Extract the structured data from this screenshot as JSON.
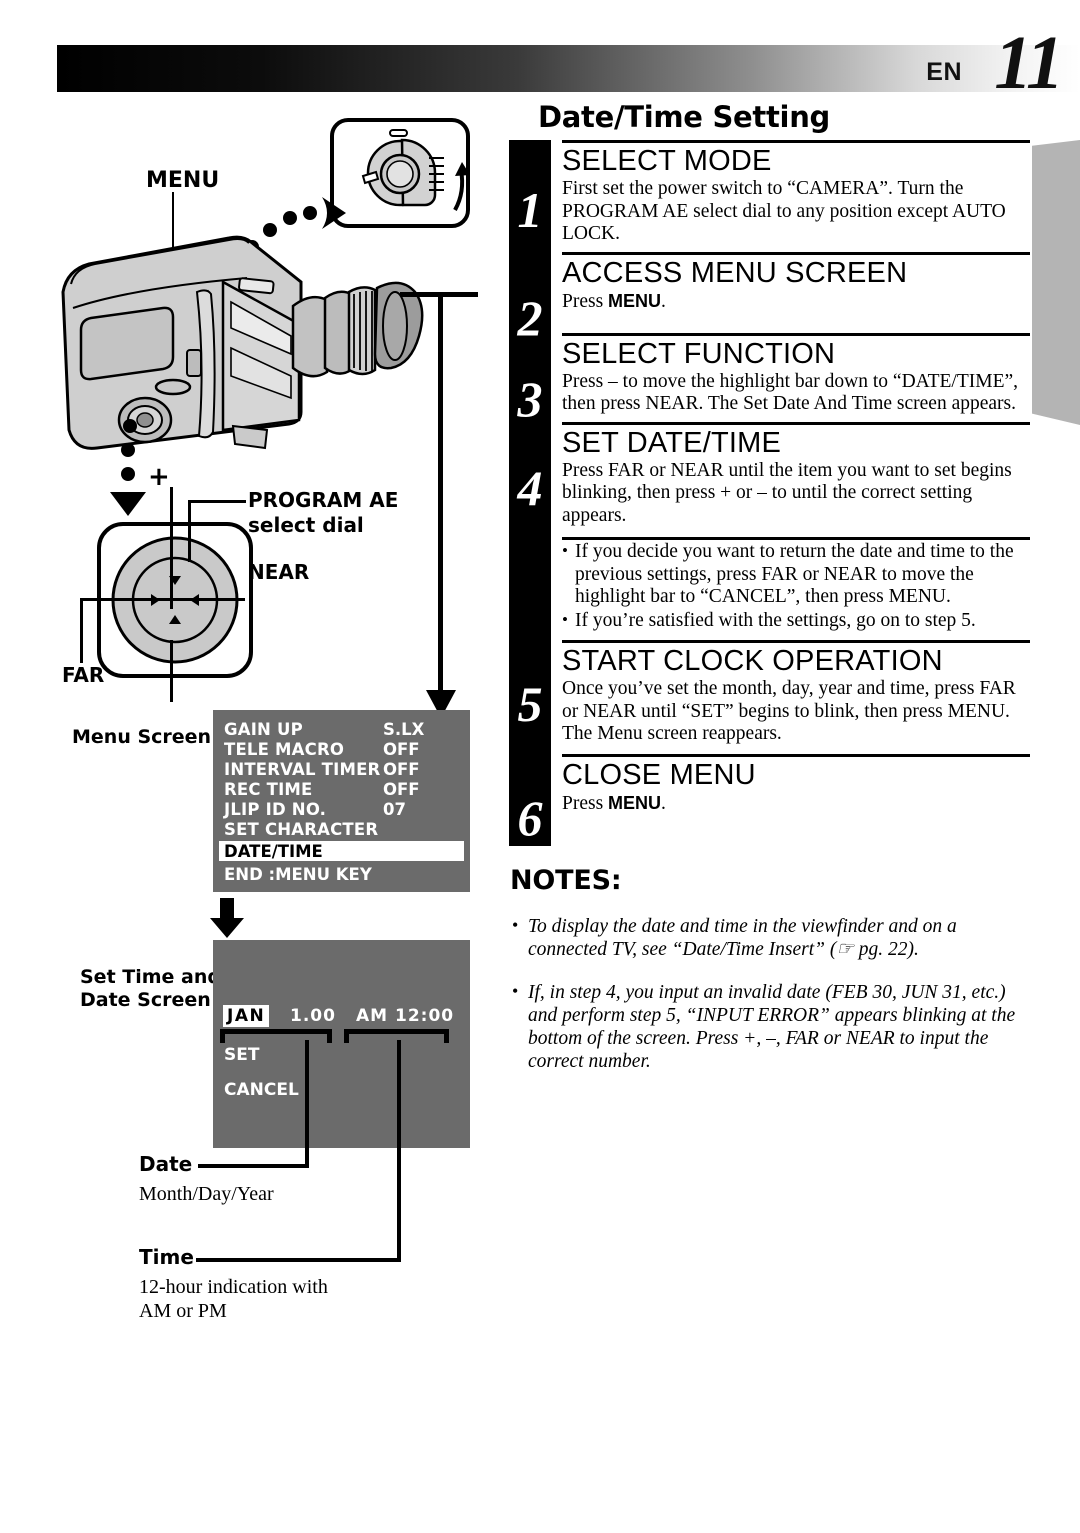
{
  "header": {
    "lang": "EN",
    "page_number": "11"
  },
  "title": "Date/Time Setting",
  "steps": [
    {
      "num": "1",
      "head": "SELECT MODE",
      "body": "First set the power switch to “CAMERA”. Turn the PROGRAM AE select dial to any position except AUTO LOCK."
    },
    {
      "num": "2",
      "head": "ACCESS MENU SCREEN",
      "body_pre": "Press ",
      "body_bold": "MENU",
      "body_post": "."
    },
    {
      "num": "3",
      "head": "SELECT FUNCTION",
      "body": "Press – to move the highlight bar down to “DATE/TIME”, then press NEAR. The Set Date And Time screen appears."
    },
    {
      "num": "4",
      "head": "SET DATE/TIME",
      "body": "Press FAR or NEAR until the item you want to set begins blinking, then press + or – to until the correct setting appears."
    },
    {
      "num": "5",
      "head": "START CLOCK OPERATION",
      "body": "Once you’ve set the month, day, year and time, press FAR or NEAR until “SET” begins to blink, then press MENU. The Menu screen reappears."
    },
    {
      "num": "6",
      "head": "CLOSE MENU",
      "body_pre": "Press ",
      "body_bold": "MENU",
      "body_post": "."
    }
  ],
  "step4_bullets": [
    "If you decide you want to return the date and time to the previous settings, press FAR or NEAR to move the highlight bar to “CANCEL”, then press MENU.",
    "If you’re satisfied with the settings, go on to step 5."
  ],
  "notes": {
    "title": "NOTES:",
    "items": [
      "To display the date and time in the viewfinder and on a connected TV, see “Date/Time Insert” (☞ pg. 22).",
      "If, in step 4, you input an invalid date (FEB 30, JUN 31, etc.) and perform step 5, “INPUT ERROR” appears blinking at the bottom of the screen. Press +, –, FAR or NEAR to input the correct number."
    ]
  },
  "diagram": {
    "menu_button_label": "MENU",
    "pad": {
      "plus": "+",
      "minus": "–",
      "far": "FAR",
      "near": "NEAR",
      "program_ae_line1": "PROGRAM AE",
      "program_ae_line2": "select dial"
    },
    "menu_screen_label": "Menu Screen",
    "date_screen_label_line1": "Set Time and",
    "date_screen_label_line2": "Date Screen"
  },
  "menu_screen": {
    "rows": [
      {
        "name": "GAIN UP",
        "value": "S.LX"
      },
      {
        "name": "TELE MACRO",
        "value": "OFF"
      },
      {
        "name": "INTERVAL TIMER",
        "value": "OFF"
      },
      {
        "name": "REC TIME",
        "value": "OFF"
      },
      {
        "name": "JLIP ID NO.",
        "value": "07"
      },
      {
        "name": "SET CHARACTER",
        "value": ""
      }
    ],
    "highlighted": "DATE/TIME",
    "footer": "END :MENU KEY"
  },
  "date_screen": {
    "month": "JAN",
    "day_year": "1.00",
    "time": "AM 12:00",
    "set": "SET",
    "cancel": "CANCEL"
  },
  "legend": {
    "date_title": "Date",
    "date_text": "Month/Day/Year",
    "time_title": "Time",
    "time_text_line1": "12-hour indication with",
    "time_text_line2": "AM or PM"
  }
}
